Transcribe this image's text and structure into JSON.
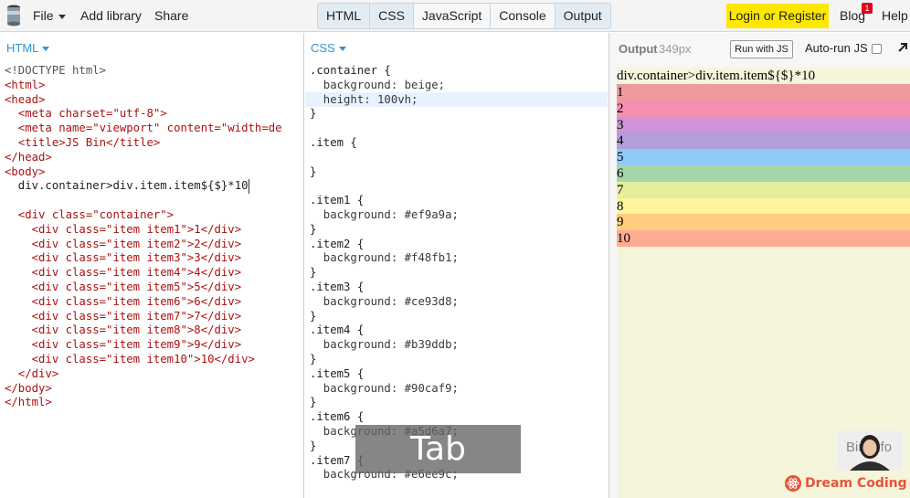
{
  "topbar": {
    "menus": {
      "file": "File",
      "add_library": "Add library",
      "share": "Share"
    },
    "tabs": [
      {
        "label": "HTML",
        "active": true
      },
      {
        "label": "CSS",
        "active": true
      },
      {
        "label": "JavaScript",
        "active": false
      },
      {
        "label": "Console",
        "active": false
      },
      {
        "label": "Output",
        "active": true
      }
    ],
    "login_label": "Login or Register",
    "blog_label": "Blog",
    "blog_badge": "1",
    "help_label": "Help"
  },
  "html_panel": {
    "label": "HTML",
    "lines": [
      "<!DOCTYPE html>",
      "<html>",
      "<head>",
      "  <meta charset=\"utf-8\">",
      "  <meta name=\"viewport\" content=\"width=de",
      "  <title>JS Bin</title>",
      "</head>",
      "<body>",
      "  div.container>div.item.item${$}*10",
      "",
      "  <div class=\"container\">",
      "    <div class=\"item item1\">1</div>",
      "    <div class=\"item item2\">2</div>",
      "    <div class=\"item item3\">3</div>",
      "    <div class=\"item item4\">4</div>",
      "    <div class=\"item item5\">5</div>",
      "    <div class=\"item item6\">6</div>",
      "    <div class=\"item item7\">7</div>",
      "    <div class=\"item item8\">8</div>",
      "    <div class=\"item item9\">9</div>",
      "    <div class=\"item item10\">10</div>",
      "  </div>",
      "</body>",
      "</html>"
    ]
  },
  "css_panel": {
    "label": "CSS",
    "lines": [
      ".container {",
      "  background: beige;",
      "  height: 100vh;",
      "}",
      "",
      ".item {",
      "",
      "}",
      "",
      ".item1 {",
      "  background: #ef9a9a;",
      "}",
      ".item2 {",
      "  background: #f48fb1;",
      "}",
      ".item3 {",
      "  background: #ce93d8;",
      "}",
      ".item4 {",
      "  background: #b39ddb;",
      "}",
      ".item5 {",
      "  background: #90caf9;",
      "}",
      ".item6 {",
      "  background: #a5d6a7;",
      "}",
      ".item7 {",
      "  background: #e6ee9c;"
    ]
  },
  "output_panel": {
    "title": "Output",
    "size": "349px",
    "run_button": "Run with JS",
    "autorun_label": "Auto-run JS",
    "preview_text": "div.container>div.item.item${$}*10",
    "items": [
      {
        "label": "1",
        "color": "#ef9a9a"
      },
      {
        "label": "2",
        "color": "#f48fb1"
      },
      {
        "label": "3",
        "color": "#ce93d8"
      },
      {
        "label": "4",
        "color": "#b39ddb"
      },
      {
        "label": "5",
        "color": "#90caf9"
      },
      {
        "label": "6",
        "color": "#a5d6a7"
      },
      {
        "label": "7",
        "color": "#e6ee9c"
      },
      {
        "label": "8",
        "color": "#fff59d"
      },
      {
        "label": "9",
        "color": "#ffcc80"
      },
      {
        "label": "10",
        "color": "#ffab91"
      }
    ]
  },
  "overlays": {
    "key_hint": "Tab",
    "bin_info": "Bin info",
    "watermark": "Dream Coding"
  },
  "icons": {
    "logo": "jsbin-logo-icon",
    "expand": "expand-arrow-icon",
    "watermark": "react-atom-icon"
  },
  "colors": {
    "accent_blue": "#2d94d6",
    "login_yellow": "#ffe800",
    "badge_red": "#e0001b",
    "preview_bg": "#f5f5dc"
  }
}
